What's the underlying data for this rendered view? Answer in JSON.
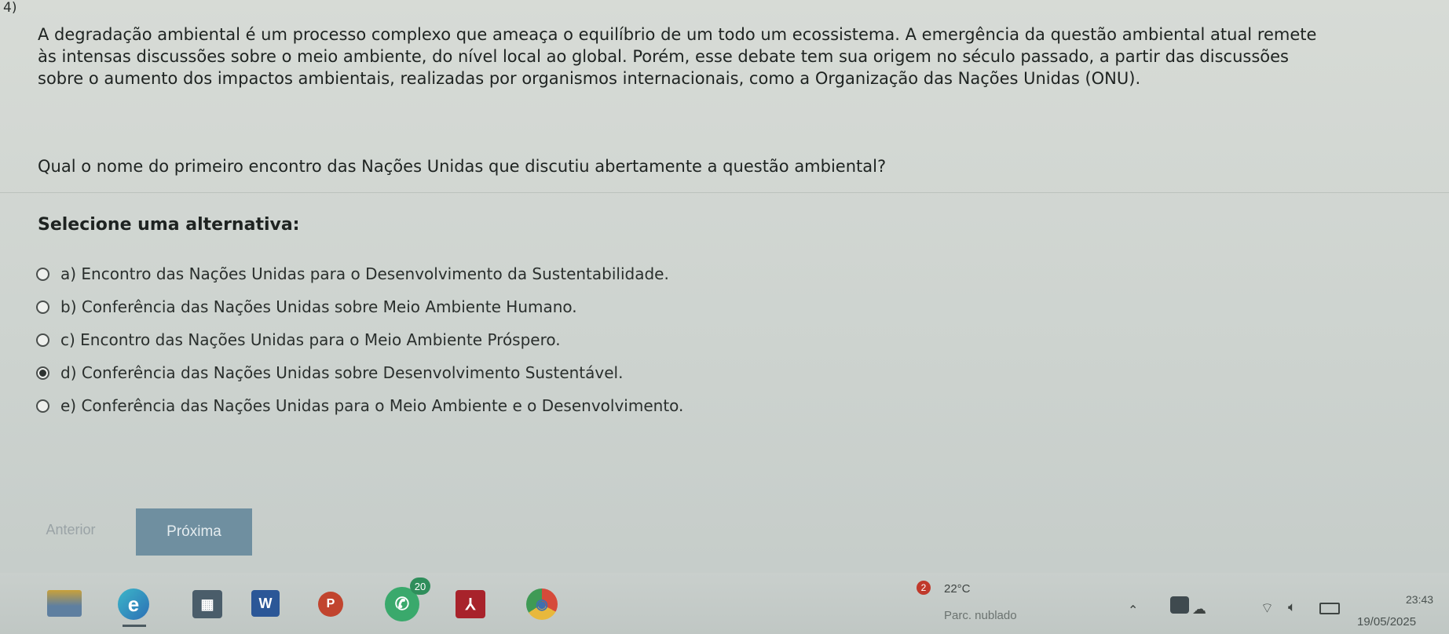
{
  "question": {
    "number": "4)",
    "paragraph_lines": [
      "A degradação ambiental é um processo complexo que ameaça o equilíbrio de um todo um ecossistema. A emergência da questão ambiental atual remete",
      "às intensas discussões sobre o meio ambiente, do nível local ao global. Porém, esse debate tem sua origem no século passado, a partir das discussões",
      "sobre o aumento dos impactos ambientais, realizadas por organismos internacionais, como a Organização das Nações Unidas (ONU)."
    ],
    "prompt": "Qual o nome do primeiro encontro das Nações Unidas que discutiu abertamente a questão ambiental?",
    "select_label": "Selecione uma alternativa:",
    "options": [
      {
        "label": "a) Encontro das Nações Unidas para o Desenvolvimento da Sustentabilidade.",
        "selected": false
      },
      {
        "label": "b) Conferência das Nações Unidas sobre Meio Ambiente Humano.",
        "selected": false
      },
      {
        "label": "c) Encontro das Nações Unidas para o Meio Ambiente Próspero.",
        "selected": false
      },
      {
        "label": "d) Conferência das Nações Unidas sobre Desenvolvimento Sustentável.",
        "selected": true
      },
      {
        "label": "e) Conferência das Nações Unidas para o Meio Ambiente e o Desenvolvimento.",
        "selected": false
      }
    ]
  },
  "navigation": {
    "prev_label": "Anterior",
    "next_label": "Próxima",
    "next_color": "#6f8fa0"
  },
  "taskbar": {
    "apps": [
      {
        "name": "file-explorer-icon",
        "glyph": ""
      },
      {
        "name": "edge-icon",
        "glyph": "e"
      },
      {
        "name": "calculator-icon",
        "glyph": "▦"
      },
      {
        "name": "word-icon",
        "glyph": "W"
      },
      {
        "name": "powerpoint-icon",
        "glyph": "P"
      },
      {
        "name": "whatsapp-icon",
        "glyph": "✆",
        "badge": "20"
      },
      {
        "name": "acrobat-icon",
        "glyph": "⅄"
      },
      {
        "name": "chrome-icon",
        "glyph": "◉"
      }
    ],
    "weather": {
      "badge": "2",
      "temperature": "22°C",
      "description": "Parc. nublado"
    },
    "clock": {
      "time": "23:43",
      "date": "19/05/2025"
    }
  }
}
